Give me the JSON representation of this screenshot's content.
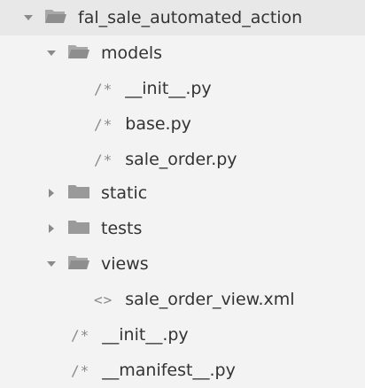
{
  "tree": {
    "root": {
      "label": "fal_sale_automated_action",
      "expanded": true
    },
    "models": {
      "label": "models",
      "expanded": true
    },
    "models_init": {
      "icon": "/*",
      "label": "__init__.py"
    },
    "models_base": {
      "icon": "/*",
      "label": "base.py"
    },
    "models_sale_order": {
      "icon": "/*",
      "label": "sale_order.py"
    },
    "static": {
      "label": "static",
      "expanded": false
    },
    "tests": {
      "label": "tests",
      "expanded": false
    },
    "views": {
      "label": "views",
      "expanded": true
    },
    "views_sale_order_view": {
      "icon": "<>",
      "label": "sale_order_view.xml"
    },
    "root_init": {
      "icon": "/*",
      "label": "__init__.py"
    },
    "root_manifest": {
      "icon": "/*",
      "label": "__manifest__.py"
    }
  },
  "colors": {
    "background": "#f3f3f3",
    "text": "#333333",
    "folder": "#9a9a9a",
    "arrow": "#8a8a8a",
    "file_icon": "#8a8a8a"
  },
  "icons": {
    "expanded_arrow": "chevron-down-icon",
    "collapsed_arrow": "chevron-right-icon",
    "open_folder": "folder-open-icon",
    "closed_folder": "folder-icon",
    "python_file": "python-file-icon",
    "xml_file": "xml-file-icon"
  }
}
